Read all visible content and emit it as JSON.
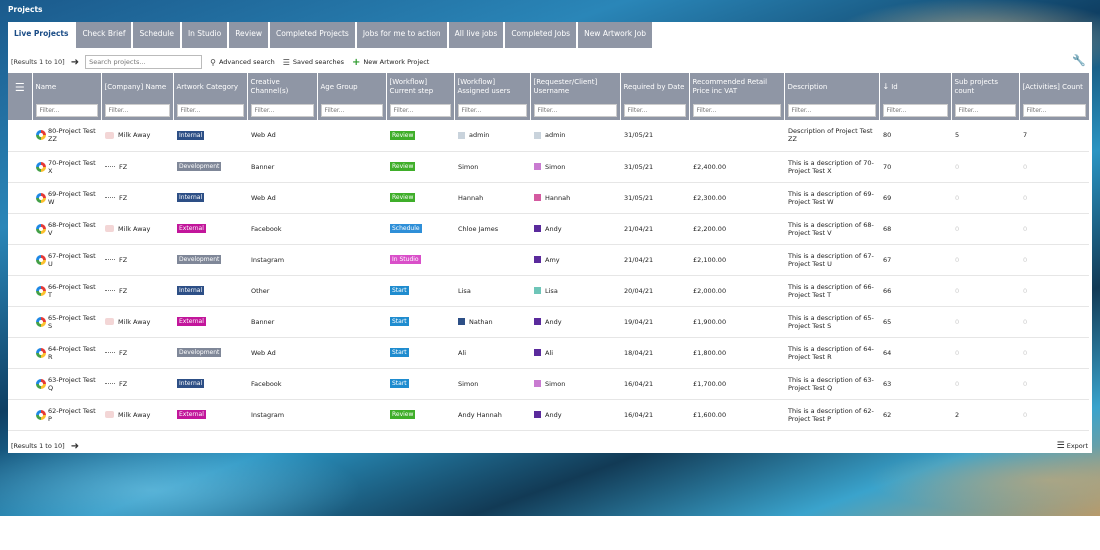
{
  "window_title": "Projects",
  "tabs": [
    "Live Projects",
    "Check Brief",
    "Schedule",
    "In Studio",
    "Review",
    "Completed Projects",
    "Jobs for me to action",
    "All live jobs",
    "Completed Jobs",
    "New Artwork Job"
  ],
  "toolbar": {
    "results": "[Results 1 to 10]",
    "search_placeholder": "Search projects...",
    "advanced_search": "Advanced search",
    "saved_searches": "Saved searches",
    "new_artwork_project": "New Artwork Project"
  },
  "columns": [
    "Name",
    "[Company] Name",
    "Artwork Category",
    "Creative Channel(s)",
    "Age Group",
    "[Workflow] Current step",
    "[Workflow] Assigned users",
    "[Requester/Client] Username",
    "Required by Date",
    "Recommended Retail Price inc VAT",
    "Description",
    "Id",
    "Sub projects count",
    "[Activities] Count"
  ],
  "filter_placeholder": "Filter...",
  "colors": {
    "Internal": "#2d4f86",
    "Development": "#7f8798",
    "External": "#c2169b",
    "Review": "#3fae2a",
    "Schedule": "#2e8fd8",
    "In Studio": "#d94fc9",
    "Start": "#1f8ccf",
    "header_bg": "#8f96a5"
  },
  "rows": [
    {
      "name": "80-Project Test ZZ",
      "company": "Milk Away",
      "co": "milk",
      "category": "Internal",
      "channel": "Web Ad",
      "age": "",
      "step": "Review",
      "assigned": "admin",
      "assigned_avatar": "#c9d3dc",
      "requester": "admin",
      "req_avatar": "#c9d3dc",
      "date": "31/05/21",
      "price": "",
      "description": "Description of Project Test ZZ",
      "id": "80",
      "sub": "5",
      "sub_muted": false,
      "activities": "7",
      "act_muted": false
    },
    {
      "name": "70-Project Test X",
      "company": "FZ",
      "co": "fz",
      "category": "Development",
      "channel": "Banner",
      "age": "",
      "step": "Review",
      "assigned": "Simon",
      "assigned_avatar": "",
      "requester": "Simon",
      "req_avatar": "#c97bd1",
      "date": "31/05/21",
      "price": "£2,400.00",
      "description": "This is a description of 70-Project Test X",
      "id": "70",
      "sub": "0",
      "sub_muted": true,
      "activities": "0",
      "act_muted": true
    },
    {
      "name": "69-Project Test W",
      "company": "FZ",
      "co": "fz",
      "category": "Internal",
      "channel": "Web Ad",
      "age": "",
      "step": "Review",
      "assigned": "Hannah",
      "assigned_avatar": "",
      "requester": "Hannah",
      "req_avatar": "#d45aa0",
      "date": "31/05/21",
      "price": "£2,300.00",
      "description": "This is a description of 69-Project Test W",
      "id": "69",
      "sub": "0",
      "sub_muted": true,
      "activities": "0",
      "act_muted": true
    },
    {
      "name": "68-Project Test V",
      "company": "Milk Away",
      "co": "milk",
      "category": "External",
      "channel": "Facebook",
      "age": "",
      "step": "Schedule",
      "assigned": "Chloe James",
      "assigned_avatar": "",
      "requester": "Andy",
      "req_avatar": "#5a2a9c",
      "date": "21/04/21",
      "price": "£2,200.00",
      "description": "This is a description of 68-Project Test V",
      "id": "68",
      "sub": "0",
      "sub_muted": true,
      "activities": "0",
      "act_muted": true
    },
    {
      "name": "67-Project Test U",
      "company": "FZ",
      "co": "fz",
      "category": "Development",
      "channel": "Instagram",
      "age": "",
      "step": "In Studio",
      "assigned": "",
      "assigned_avatar": "",
      "requester": "Amy",
      "req_avatar": "#5a2a9c",
      "date": "21/04/21",
      "price": "£2,100.00",
      "description": "This is a description of 67-Project Test U",
      "id": "67",
      "sub": "0",
      "sub_muted": true,
      "activities": "0",
      "act_muted": true
    },
    {
      "name": "66-Project Test T",
      "company": "FZ",
      "co": "fz",
      "category": "Internal",
      "channel": "Other",
      "age": "",
      "step": "Start",
      "assigned": "Lisa",
      "assigned_avatar": "",
      "requester": "Lisa",
      "req_avatar": "#6ec5b8",
      "date": "20/04/21",
      "price": "£2,000.00",
      "description": "This is a description of 66-Project Test T",
      "id": "66",
      "sub": "0",
      "sub_muted": true,
      "activities": "0",
      "act_muted": true
    },
    {
      "name": "65-Project Test S",
      "company": "Milk Away",
      "co": "milk",
      "category": "External",
      "channel": "Banner",
      "age": "",
      "step": "Start",
      "assigned": "Nathan",
      "assigned_avatar": "#2d4f86",
      "requester": "Andy",
      "req_avatar": "#5a2a9c",
      "date": "19/04/21",
      "price": "£1,900.00",
      "description": "This is a description of 65-Project Test S",
      "id": "65",
      "sub": "0",
      "sub_muted": true,
      "activities": "0",
      "act_muted": true
    },
    {
      "name": "64-Project Test R",
      "company": "FZ",
      "co": "fz",
      "category": "Development",
      "channel": "Web Ad",
      "age": "",
      "step": "Start",
      "assigned": "Ali",
      "assigned_avatar": "",
      "requester": "Ali",
      "req_avatar": "#5a2a9c",
      "date": "18/04/21",
      "price": "£1,800.00",
      "description": "This is a description of 64-Project Test R",
      "id": "64",
      "sub": "0",
      "sub_muted": true,
      "activities": "0",
      "act_muted": true
    },
    {
      "name": "63-Project Test Q",
      "company": "FZ",
      "co": "fz",
      "category": "Internal",
      "channel": "Facebook",
      "age": "",
      "step": "Start",
      "assigned": "Simon",
      "assigned_avatar": "",
      "requester": "Simon",
      "req_avatar": "#c97bd1",
      "date": "16/04/21",
      "price": "£1,700.00",
      "description": "This is a description of 63-Project Test Q",
      "id": "63",
      "sub": "0",
      "sub_muted": true,
      "activities": "0",
      "act_muted": true
    },
    {
      "name": "62-Project Test P",
      "company": "Milk Away",
      "co": "milk",
      "category": "External",
      "channel": "Instagram",
      "age": "",
      "step": "Review",
      "assigned": "Andy Hannah",
      "assigned_avatar": "",
      "requester": "Andy",
      "req_avatar": "#5a2a9c",
      "date": "16/04/21",
      "price": "£1,600.00",
      "description": "This is a description of 62-Project Test P",
      "id": "62",
      "sub": "2",
      "sub_muted": false,
      "activities": "0",
      "act_muted": true
    }
  ],
  "footer": {
    "results": "[Results 1 to 10]",
    "export": "Export"
  }
}
